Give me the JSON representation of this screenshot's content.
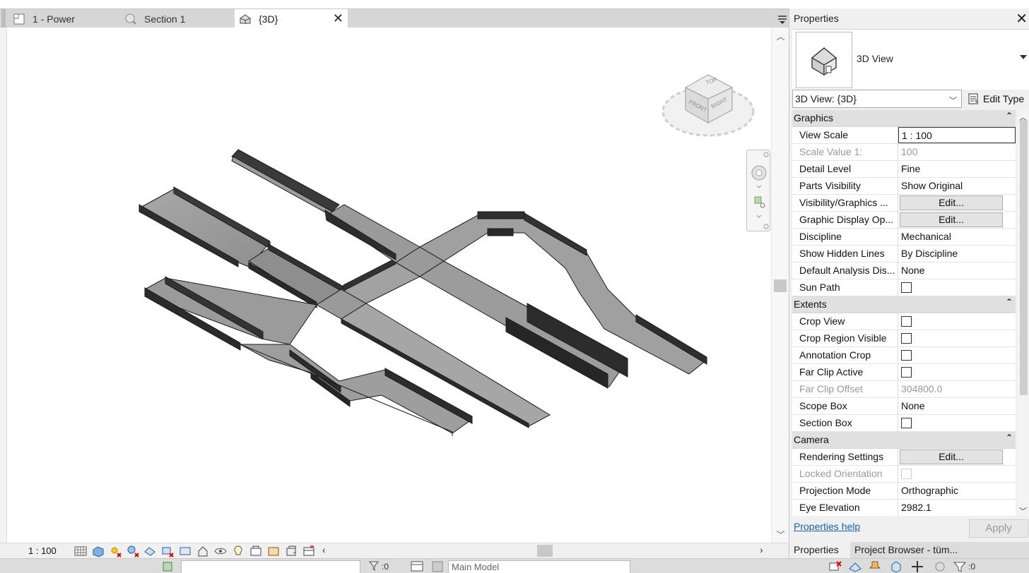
{
  "tabs": [
    {
      "label": "1 - Power",
      "icon": "floor-plan-icon"
    },
    {
      "label": "Section 1",
      "icon": "section-view-icon"
    },
    {
      "label": "{3D}",
      "icon": "3d-house-icon",
      "active": true
    }
  ],
  "viewcube": {
    "top": "TOP",
    "front": "FRONT",
    "right": "RIGHT"
  },
  "view_controls": {
    "scale": "1 : 100"
  },
  "statusbar": {
    "workset_value": "",
    "sel_count": ":0",
    "model": "Main Model",
    "filter_count": ":0"
  },
  "properties": {
    "title": "Properties",
    "type_name": "3D View",
    "view_selector": "3D View: {3D}",
    "edit_type": "Edit Type",
    "groups": [
      {
        "name": "Graphics",
        "rows": [
          {
            "name": "View Scale",
            "value": "1 : 100",
            "kind": "outlined"
          },
          {
            "name": "Scale Value    1:",
            "value": "100",
            "kind": "dim"
          },
          {
            "name": "Detail Level",
            "value": "Fine"
          },
          {
            "name": "Parts Visibility",
            "value": "Show Original"
          },
          {
            "name": "Visibility/Graphics ...",
            "value": "Edit...",
            "kind": "button"
          },
          {
            "name": "Graphic Display Op...",
            "value": "Edit...",
            "kind": "button"
          },
          {
            "name": "Discipline",
            "value": "Mechanical"
          },
          {
            "name": "Show Hidden Lines",
            "value": "By Discipline"
          },
          {
            "name": "Default Analysis Dis...",
            "value": "None"
          },
          {
            "name": "Sun Path",
            "value": "",
            "kind": "checkbox"
          }
        ]
      },
      {
        "name": "Extents",
        "rows": [
          {
            "name": "Crop View",
            "value": "",
            "kind": "checkbox"
          },
          {
            "name": "Crop Region Visible",
            "value": "",
            "kind": "checkbox"
          },
          {
            "name": "Annotation Crop",
            "value": "",
            "kind": "checkbox"
          },
          {
            "name": "Far Clip Active",
            "value": "",
            "kind": "checkbox"
          },
          {
            "name": "Far Clip Offset",
            "value": "304800.0",
            "kind": "dim"
          },
          {
            "name": "Scope Box",
            "value": "None"
          },
          {
            "name": "Section Box",
            "value": "",
            "kind": "checkbox"
          }
        ]
      },
      {
        "name": "Camera",
        "rows": [
          {
            "name": "Rendering Settings",
            "value": "Edit...",
            "kind": "button"
          },
          {
            "name": "Locked Orientation",
            "value": "",
            "kind": "checkbox-disabled"
          },
          {
            "name": "Projection Mode",
            "value": "Orthographic"
          },
          {
            "name": "Eye Elevation",
            "value": "2982.1"
          }
        ]
      }
    ],
    "help": "Properties help",
    "apply": "Apply",
    "bottom_tabs": [
      "Properties",
      "Project Browser - tüm..."
    ]
  }
}
